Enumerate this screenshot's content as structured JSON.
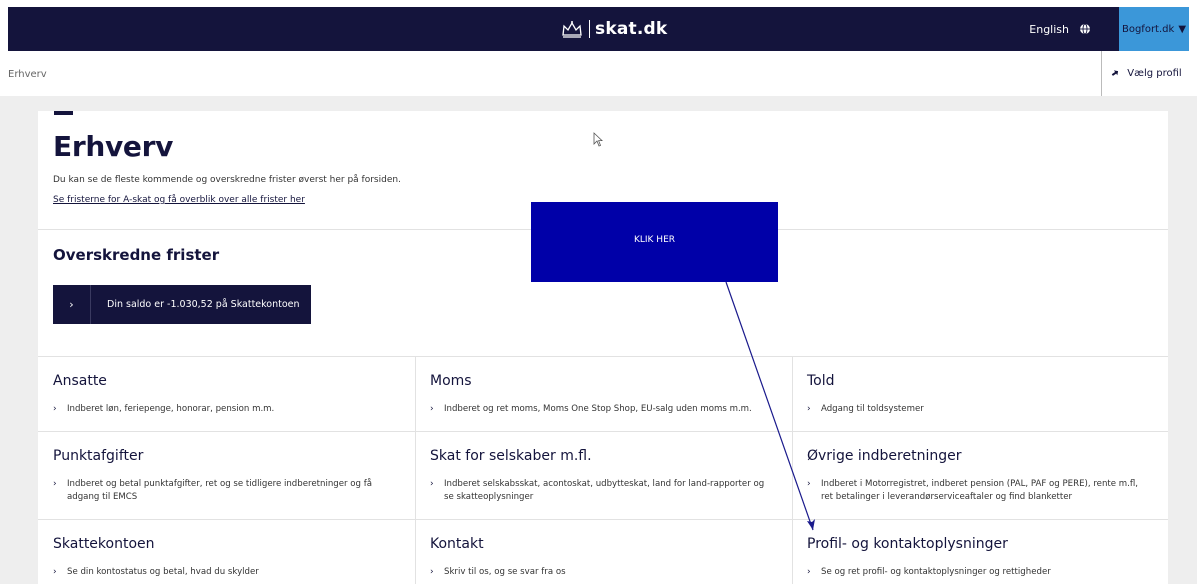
{
  "header": {
    "brand": "skat.dk",
    "language": "English",
    "user_button": "Bogfort.dk"
  },
  "breadcrumb": {
    "current": "Erhverv",
    "profile_button": "Vælg profil"
  },
  "main": {
    "title": "Erhverv",
    "intro": "Du kan se de fleste kommende og overskredne frister øverst her på forsiden.",
    "deadlines_link": "Se fristerne for A-skat og få overblik over alle frister her",
    "overdue_title": "Overskredne frister",
    "saldo_button": "Din saldo er -1.030,52 på Skattekontoen"
  },
  "overlay": {
    "cta_label": "KLIK HER"
  },
  "tiles": [
    {
      "title": "Ansatte",
      "desc": "Indberet løn, feriepenge, honorar, pension m.m."
    },
    {
      "title": "Moms",
      "desc": "Indberet og ret moms, Moms One Stop Shop, EU-salg uden moms m.m."
    },
    {
      "title": "Told",
      "desc": "Adgang til toldsystemer"
    },
    {
      "title": "Punktafgifter",
      "desc": "Indberet og betal punktafgifter, ret og se tidligere indberetninger og få adgang til EMCS"
    },
    {
      "title": "Skat for selskaber m.fl.",
      "desc": "Indberet selskabsskat, acontoskat, udbytteskat, land for land-rapporter og se skatteoplysninger"
    },
    {
      "title": "Øvrige indberetninger",
      "desc": "Indberet i Motorregistret, indberet pension (PAL, PAF og PERE), rente m.fl, ret betalinger i leverandørserviceaftaler og find blanketter"
    },
    {
      "title": "Skattekontoen",
      "desc": "Se din kontostatus og betal, hvad du skylder"
    },
    {
      "title": "Kontakt",
      "desc": "Skriv til os, og se svar fra os"
    },
    {
      "title": "Profil- og kontaktoplysninger",
      "desc": "Se og ret profil- og kontaktoplysninger og rettigheder"
    }
  ],
  "colors": {
    "navy": "#14143c",
    "accent_blue": "#3b97d9",
    "cta_blue": "#0000a8"
  }
}
